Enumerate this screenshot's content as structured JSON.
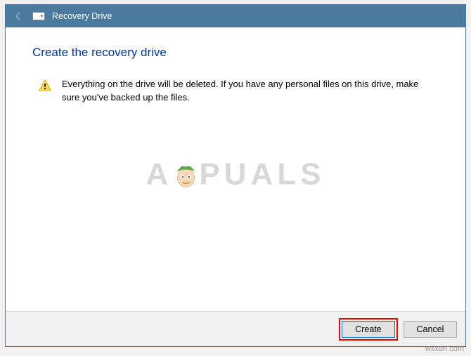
{
  "titlebar": {
    "title": "Recovery Drive"
  },
  "content": {
    "heading": "Create the recovery drive",
    "warning_text": "Everything on the drive will be deleted. If you have any personal files on this drive, make sure you've backed up the files."
  },
  "buttons": {
    "create": "Create",
    "cancel": "Cancel"
  },
  "watermark": {
    "left": "A",
    "right": "PUALS"
  },
  "attribution": "wsxdn.com"
}
